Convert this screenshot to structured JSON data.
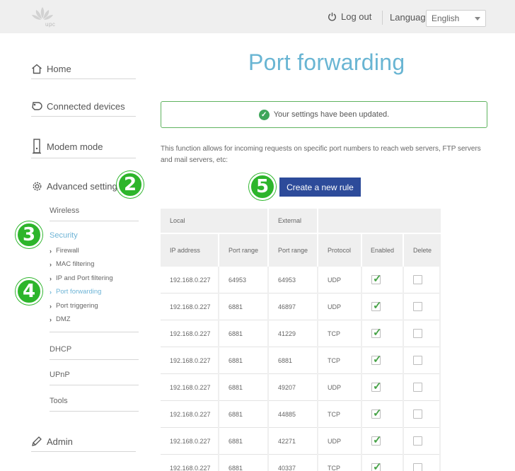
{
  "header": {
    "brand": "upc",
    "logout_label": "Log out",
    "language_label": "Language",
    "language_value": "English"
  },
  "sidebar": {
    "items": [
      {
        "label": "Home",
        "icon": "home-icon"
      },
      {
        "label": "Connected devices",
        "icon": "devices-icon"
      },
      {
        "label": "Modem mode",
        "icon": "modem-icon"
      },
      {
        "label": "Advanced settings",
        "icon": "gear-icon"
      }
    ],
    "advanced": {
      "wireless": "Wireless",
      "security": "Security",
      "security_items": [
        "Firewall",
        "MAC filtering",
        "IP and Port filtering",
        "Port forwarding",
        "Port triggering",
        "DMZ"
      ],
      "active_item": "Port forwarding",
      "dhcp": "DHCP",
      "upnp": "UPnP",
      "tools": "Tools"
    },
    "admin": {
      "label": "Admin",
      "icon": "pencil-icon"
    }
  },
  "steps": [
    "2",
    "3",
    "4",
    "5"
  ],
  "main": {
    "title": "Port forwarding",
    "alert": "Your settings have been updated.",
    "description": "This function allows for incoming requests on specific port numbers to reach web servers, FTP servers and mail servers, etc:",
    "create_button": "Create a new rule"
  },
  "table": {
    "group_headers": {
      "local": "Local",
      "external": "External"
    },
    "headers": {
      "ip": "IP address",
      "local_port_range": "Port range",
      "external_port_range": "Port range",
      "protocol": "Protocol",
      "enabled": "Enabled",
      "delete": "Delete"
    },
    "rows": [
      {
        "ip": "192.168.0.227",
        "local_port": "64953",
        "external_port": "64953",
        "protocol": "UDP",
        "enabled": true,
        "delete": false
      },
      {
        "ip": "192.168.0.227",
        "local_port": "6881",
        "external_port": "46897",
        "protocol": "UDP",
        "enabled": true,
        "delete": false
      },
      {
        "ip": "192.168.0.227",
        "local_port": "6881",
        "external_port": "41229",
        "protocol": "TCP",
        "enabled": true,
        "delete": false
      },
      {
        "ip": "192.168.0.227",
        "local_port": "6881",
        "external_port": "6881",
        "protocol": "TCP",
        "enabled": true,
        "delete": false
      },
      {
        "ip": "192.168.0.227",
        "local_port": "6881",
        "external_port": "49207",
        "protocol": "UDP",
        "enabled": true,
        "delete": false
      },
      {
        "ip": "192.168.0.227",
        "local_port": "6881",
        "external_port": "44885",
        "protocol": "TCP",
        "enabled": true,
        "delete": false
      },
      {
        "ip": "192.168.0.227",
        "local_port": "6881",
        "external_port": "42271",
        "protocol": "UDP",
        "enabled": true,
        "delete": false
      },
      {
        "ip": "192.168.0.227",
        "local_port": "6881",
        "external_port": "40337",
        "protocol": "TCP",
        "enabled": true,
        "delete": false
      }
    ]
  },
  "colors": {
    "accent": "#69b5d3",
    "button": "#2d4b9a",
    "success": "#3fa65a",
    "step_marker": "#2db52b"
  }
}
